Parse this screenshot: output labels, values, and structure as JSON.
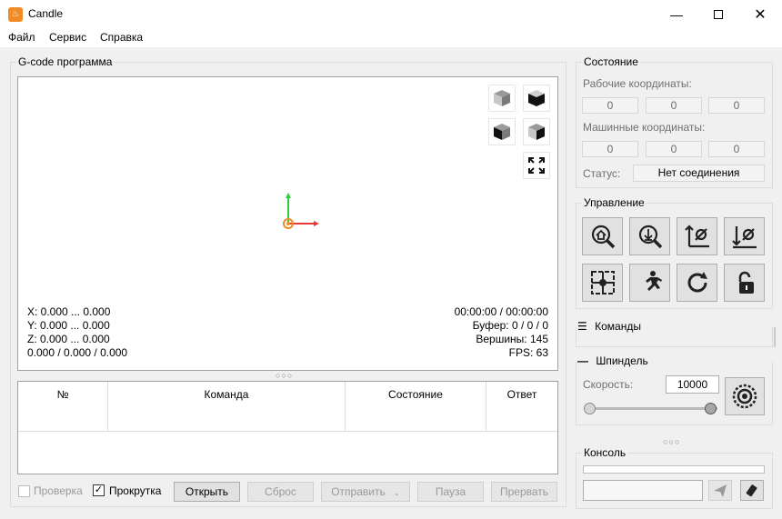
{
  "window": {
    "title": "Candle",
    "icon_char": "♨"
  },
  "menu": [
    {
      "label": "Файл"
    },
    {
      "label": "Сервис"
    },
    {
      "label": "Справка"
    }
  ],
  "gcode": {
    "group_title": "G-code программа",
    "info_left": [
      "X: 0.000 ... 0.000",
      "Y: 0.000 ... 0.000",
      "Z: 0.000 ... 0.000",
      "0.000 / 0.000 / 0.000"
    ],
    "info_right": [
      "00:00:00 / 00:00:00",
      "Буфер: 0 / 0 / 0",
      "Вершины: 145",
      "FPS: 63"
    ]
  },
  "table": {
    "columns": [
      "№",
      "Команда",
      "Состояние",
      "Ответ"
    ]
  },
  "bottom": {
    "check_label": "Проверка",
    "scroll_label": "Прокрутка",
    "open_label": "Открыть",
    "reset_label": "Сброс",
    "send_label": "Отправить",
    "pause_label": "Пауза",
    "abort_label": "Прервать"
  },
  "state": {
    "group_title": "Состояние",
    "work_label": "Рабочие координаты:",
    "work": [
      "0",
      "0",
      "0"
    ],
    "machine_label": "Машинные координаты:",
    "machine": [
      "0",
      "0",
      "0"
    ],
    "status_label": "Статус:",
    "status_value": "Нет соединения"
  },
  "control": {
    "group_title": "Управление"
  },
  "commands": {
    "title": "Команды"
  },
  "spindle": {
    "title": "Шпиндель",
    "speed_label": "Скорость:",
    "speed_value": "10000"
  },
  "console": {
    "title": "Консоль"
  },
  "colors": {
    "accent_orange": "#f08a24",
    "axis_x": "#e53935",
    "axis_y": "#2ecc40"
  }
}
